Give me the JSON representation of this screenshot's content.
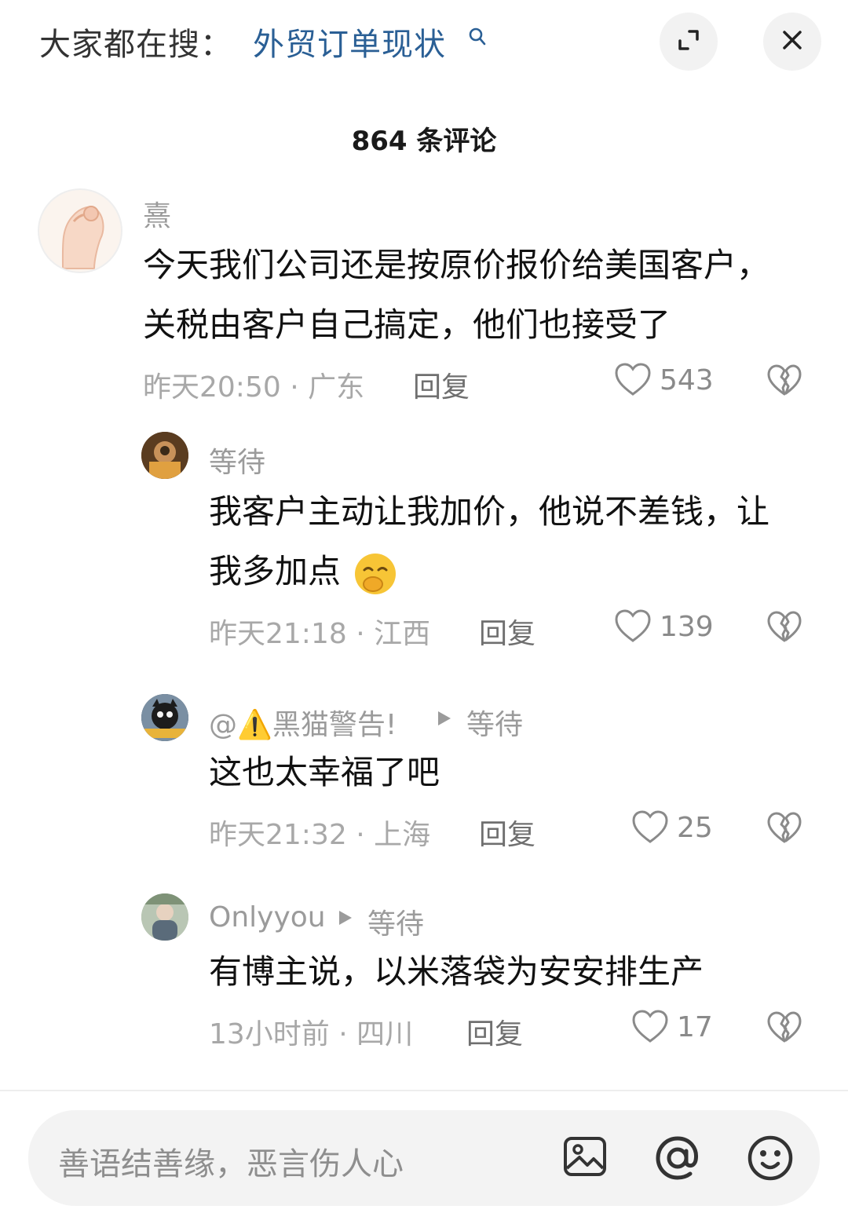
{
  "header": {
    "search_prefix": "大家都在搜：",
    "search_term": "外贸订单现状",
    "search_icon": "search-icon",
    "expand_icon": "expand-icon",
    "close_icon": "close-icon"
  },
  "comment_count_title": "864 条评论",
  "comments": [
    {
      "username": "熹",
      "lines": [
        "今天我们公司还是按原价报价给美国客户，",
        "关税由客户自己搞定，他们也接受了"
      ],
      "time_location": "昨天20:50 · 广东",
      "reply_label": "回复",
      "likes": "543"
    },
    {
      "username": "等待",
      "lines": [
        "我客户主动让我加价，他说不差钱，让",
        "我多加点"
      ],
      "emoji": "shy-giggle-emoji",
      "time_location": "昨天21:18 · 江西",
      "reply_label": "回复",
      "likes": "139"
    },
    {
      "username": "@⚠️黑猫警告!",
      "reply_to": "等待",
      "lines": [
        "这也太幸福了吧"
      ],
      "time_location": "昨天21:32 · 上海",
      "reply_label": "回复",
      "likes": "25"
    },
    {
      "username": "Onlyyou",
      "reply_to": "等待",
      "lines": [
        "有博主说，以米落袋为安安排生产"
      ],
      "time_location": "13小时前 · 四川",
      "reply_label": "回复",
      "likes": "17"
    }
  ],
  "input_bar": {
    "placeholder": "善语结善缘，恶言伤人心",
    "icons": [
      "image-icon",
      "at-icon",
      "emoji-icon"
    ]
  }
}
